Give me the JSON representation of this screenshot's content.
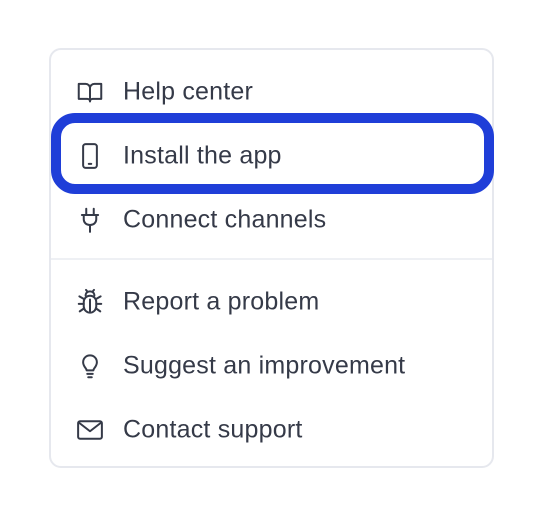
{
  "menu": {
    "items": [
      {
        "label": "Help center",
        "icon": "book-open-icon"
      },
      {
        "label": "Install the app",
        "icon": "mobile-device-icon"
      },
      {
        "label": "Connect channels",
        "icon": "plug-icon"
      },
      {
        "label": "Report a problem",
        "icon": "bug-icon"
      },
      {
        "label": "Suggest an improvement",
        "icon": "lightbulb-icon"
      },
      {
        "label": "Contact support",
        "icon": "envelope-icon"
      }
    ]
  },
  "colors": {
    "text": "#353a48",
    "icon": "#353a48",
    "border": "#e6e8ee",
    "divider": "#eef0f4",
    "focus_ring": "#1f3ed8"
  }
}
